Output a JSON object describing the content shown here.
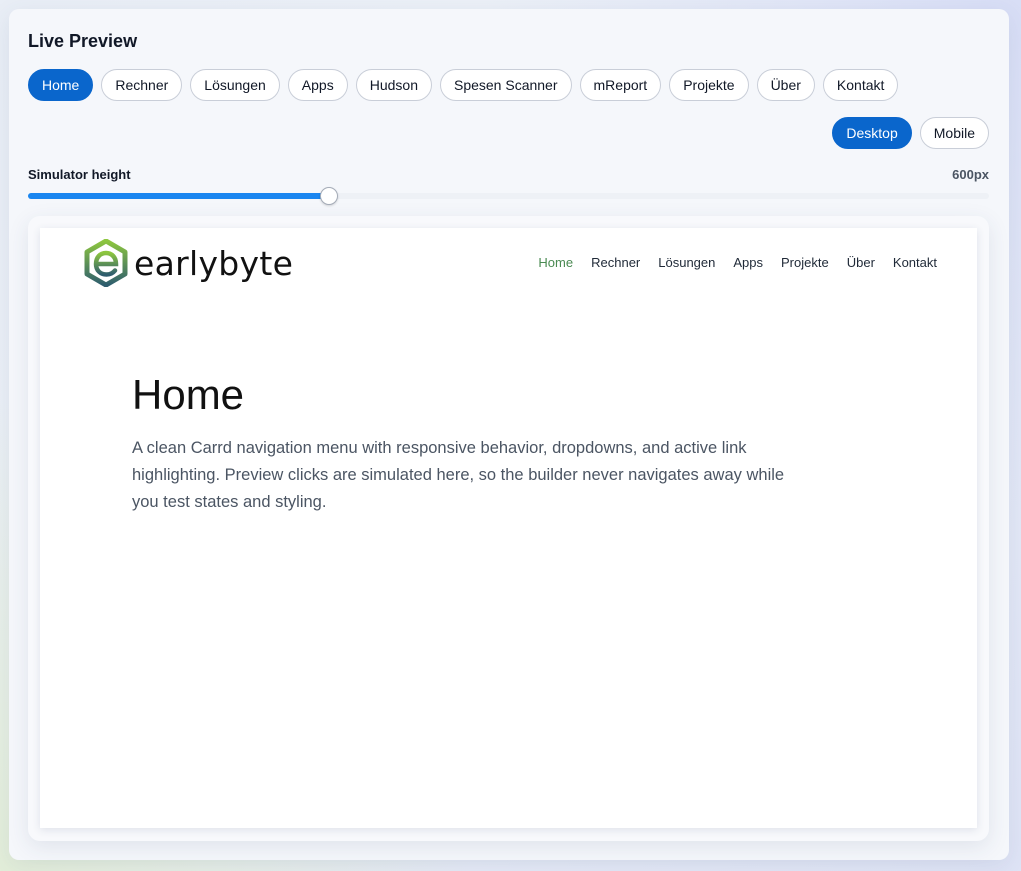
{
  "panel": {
    "title": "Live Preview"
  },
  "tabs": [
    {
      "label": "Home",
      "active": true
    },
    {
      "label": "Rechner",
      "active": false
    },
    {
      "label": "Lösungen",
      "active": false
    },
    {
      "label": "Apps",
      "active": false
    },
    {
      "label": "Hudson",
      "active": false
    },
    {
      "label": "Spesen Scanner",
      "active": false
    },
    {
      "label": "mReport",
      "active": false
    },
    {
      "label": "Projekte",
      "active": false
    },
    {
      "label": "Über",
      "active": false
    },
    {
      "label": "Kontakt",
      "active": false
    }
  ],
  "view_toggle": {
    "desktop_label": "Desktop",
    "mobile_label": "Mobile",
    "selected": "Desktop"
  },
  "simulator": {
    "label": "Simulator height",
    "value_text": "600px",
    "slider_fraction": 0.313
  },
  "site": {
    "logo_text": "earlybyte",
    "nav": [
      {
        "label": "Home",
        "active": true
      },
      {
        "label": "Rechner",
        "active": false
      },
      {
        "label": "Lösungen",
        "active": false
      },
      {
        "label": "Apps",
        "active": false
      },
      {
        "label": "Projekte",
        "active": false
      },
      {
        "label": "Über",
        "active": false
      },
      {
        "label": "Kontakt",
        "active": false
      }
    ],
    "hero_title": "Home",
    "hero_text": "A clean Carrd navigation menu with responsive behavior, dropdowns, and active link highlighting. Preview clicks are simulated here, so the builder never navigates away while you test states and styling."
  },
  "colors": {
    "accent": "#0a66cc",
    "slider_fill": "#1a86f0",
    "site_active_link": "#4a8a52",
    "logo_green": "#8dc63f",
    "logo_teal": "#2e5d6e"
  },
  "icons": {
    "logo_mark": "earlybyte-hexagon-e-icon"
  }
}
